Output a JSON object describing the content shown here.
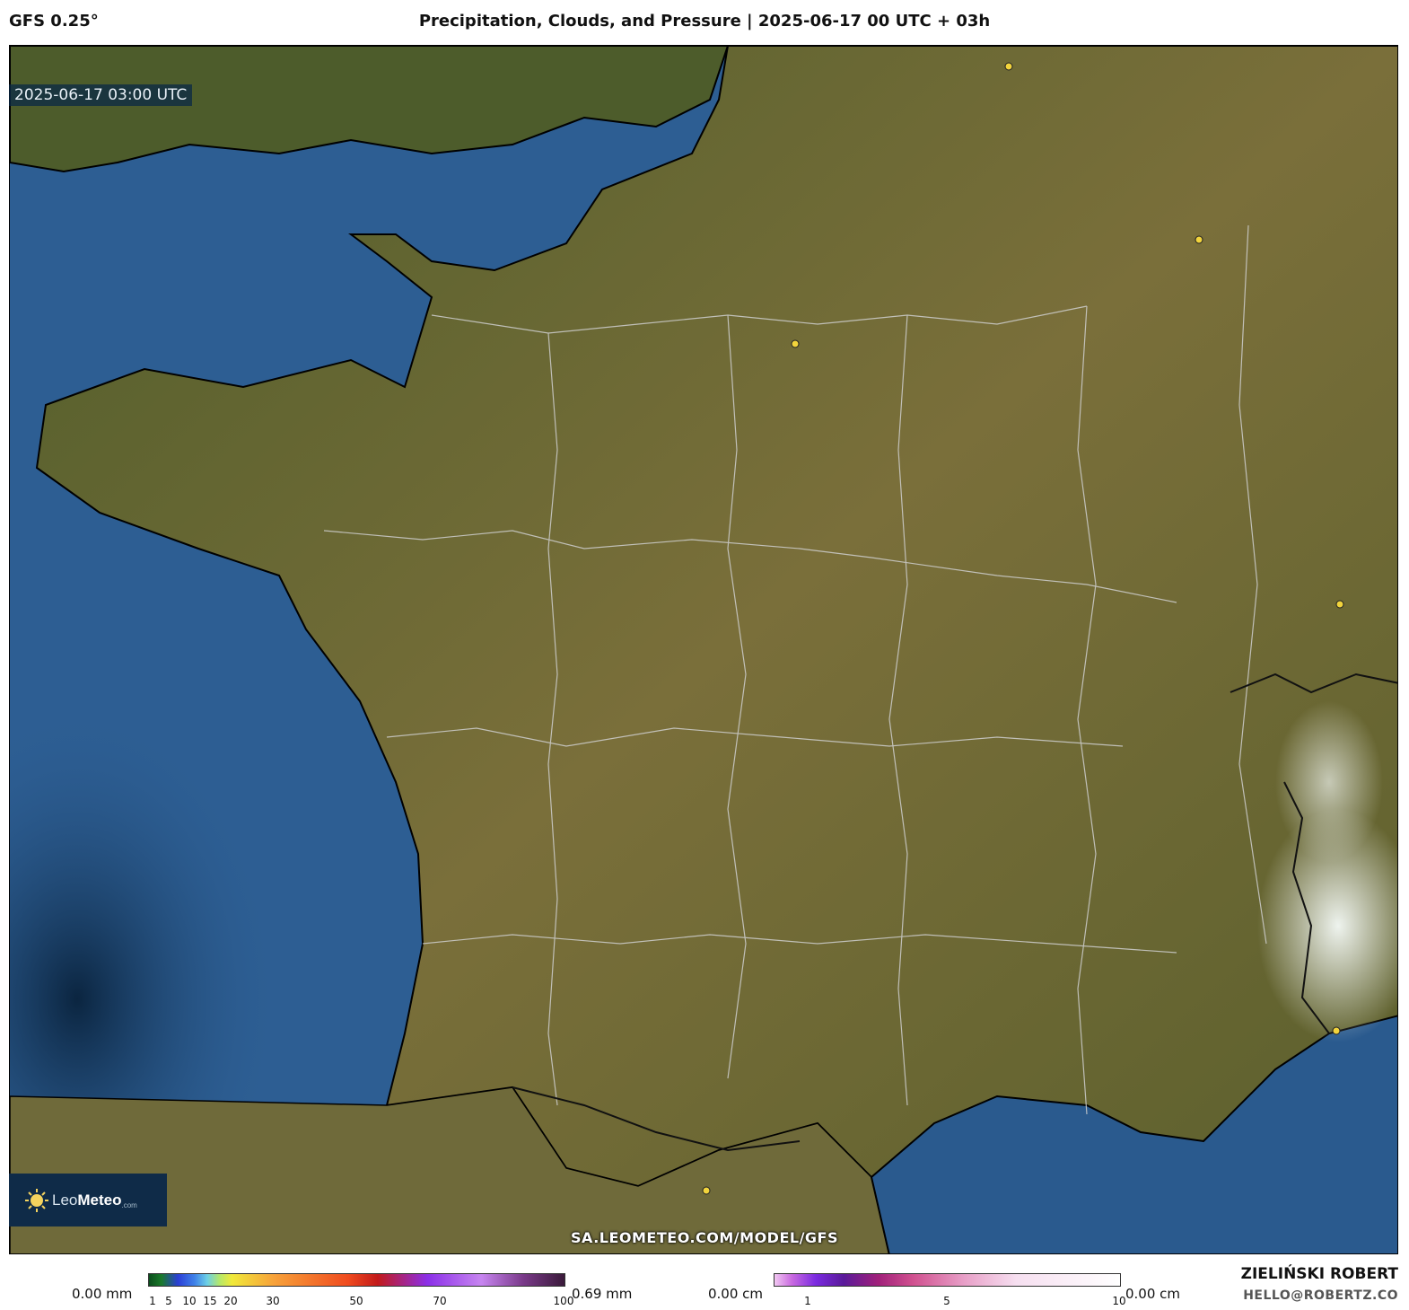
{
  "header": {
    "model": "GFS 0.25°",
    "title": "Precipitation, Clouds, and Pressure | 2025-06-17 00 UTC + 03h"
  },
  "map": {
    "timestamp": "2025-06-17 03:00 UTC",
    "watermark": "SA.LEOMETEO.COM/MODEL/GFS",
    "colors": {
      "sea": "#2d5e93",
      "deep_sea": "#0b2540",
      "land": "#6b6a35",
      "snow_cloud": "#e8eee8",
      "border": "#cfcfcf",
      "city_marker": "#f2d43c"
    },
    "logo": {
      "part1": "Leo",
      "part2": "Meteo",
      "part3": ".com"
    }
  },
  "legend": {
    "precipitation": {
      "min": "0.00 mm",
      "max": "0.69 mm",
      "ticks": [
        "1",
        "5",
        "10",
        "15",
        "20",
        "30",
        "50",
        "70",
        "100"
      ]
    },
    "snow": {
      "min": "0.00 cm",
      "max": "0.00 cm",
      "ticks": [
        "1",
        "5",
        "10"
      ]
    }
  },
  "author": {
    "name": "ZIELIŃSKI ROBERT",
    "email": "HELLO@ROBERTZ.CO"
  }
}
